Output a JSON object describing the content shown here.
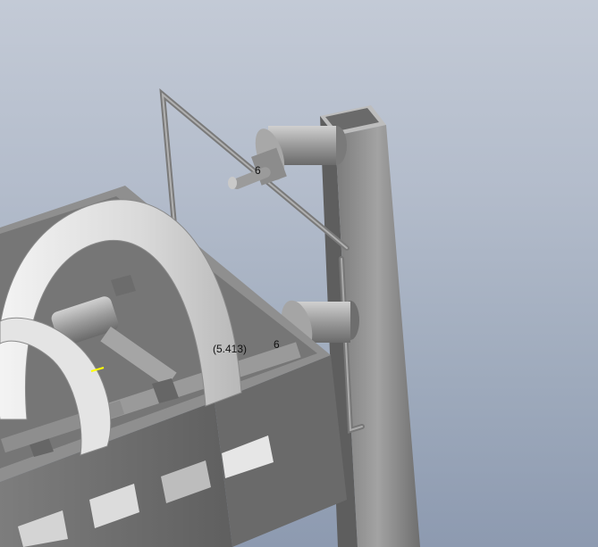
{
  "viewport": {
    "background_top": "#c3cad6",
    "background_bottom": "#8d9ab0"
  },
  "annotations": {
    "dim_top": "6",
    "dim_reference": "(5.413)",
    "dim_right": "6"
  },
  "colors": {
    "steel_light": "#c9c9c9",
    "steel_mid": "#8a8a8a",
    "steel_dark": "#5c5c5c",
    "highlight": "#ffff00"
  }
}
